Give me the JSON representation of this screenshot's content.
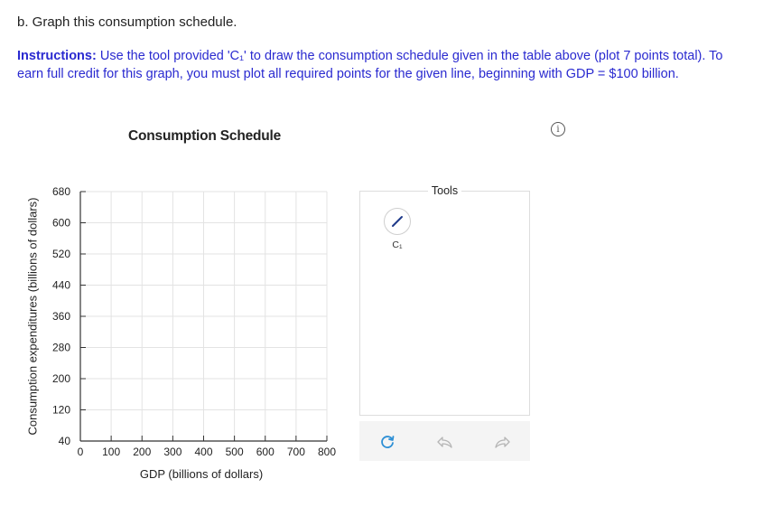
{
  "question": {
    "title": "b. Graph this consumption schedule.",
    "instructions_label": "Instructions:",
    "instructions_text": " Use the tool provided 'C₁' to draw the consumption schedule given in the table above (plot 7 points total). To earn full credit for this graph, you must plot all required points for the given line, beginning with GDP = $100 billion."
  },
  "chart_data": {
    "type": "scatter",
    "title": "Consumption Schedule",
    "xlabel": "GDP (billions of dollars)",
    "ylabel": "Consumption expenditures (billions of dollars)",
    "x_ticks": [
      "0",
      "100",
      "200",
      "300",
      "400",
      "500",
      "600",
      "700",
      "800"
    ],
    "y_ticks": [
      "40",
      "120",
      "200",
      "280",
      "360",
      "440",
      "520",
      "600",
      "680"
    ],
    "xlim": [
      0,
      800
    ],
    "ylim": [
      40,
      680
    ],
    "grid": true,
    "series": []
  },
  "tools": {
    "title": "Tools",
    "line_tool_label": "C₁",
    "line_tool_color": "#1f3a8a"
  },
  "colors": {
    "instructions": "#2a2ad0",
    "grid": "#e3e3e3",
    "axis": "#333333",
    "reset_icon": "#2d8fd5",
    "disabled_icon": "#b5b5b5"
  },
  "icons": {
    "info": "info-icon",
    "line_tool": "line-tool-icon",
    "reset": "reset-icon",
    "undo": "undo-icon",
    "redo": "redo-icon"
  }
}
